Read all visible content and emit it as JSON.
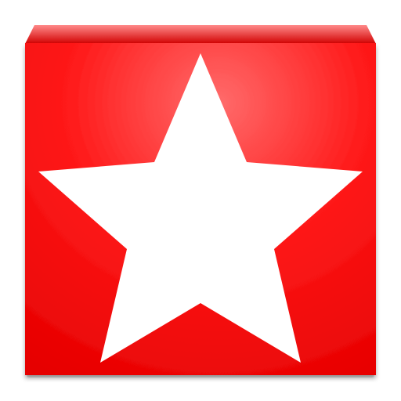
{
  "app_icon": {
    "name": "star-app-icon",
    "colors": {
      "tile_highlight": "#ff6b6b",
      "tile_main": "#ff1a1a",
      "tile_dark": "#e60000",
      "bevel_light": "#ff8a8a",
      "bevel_dark": "#d10000",
      "star": "#ffffff",
      "shadow": "#000000",
      "background": "#ffffff"
    },
    "glyph": "star-icon"
  }
}
